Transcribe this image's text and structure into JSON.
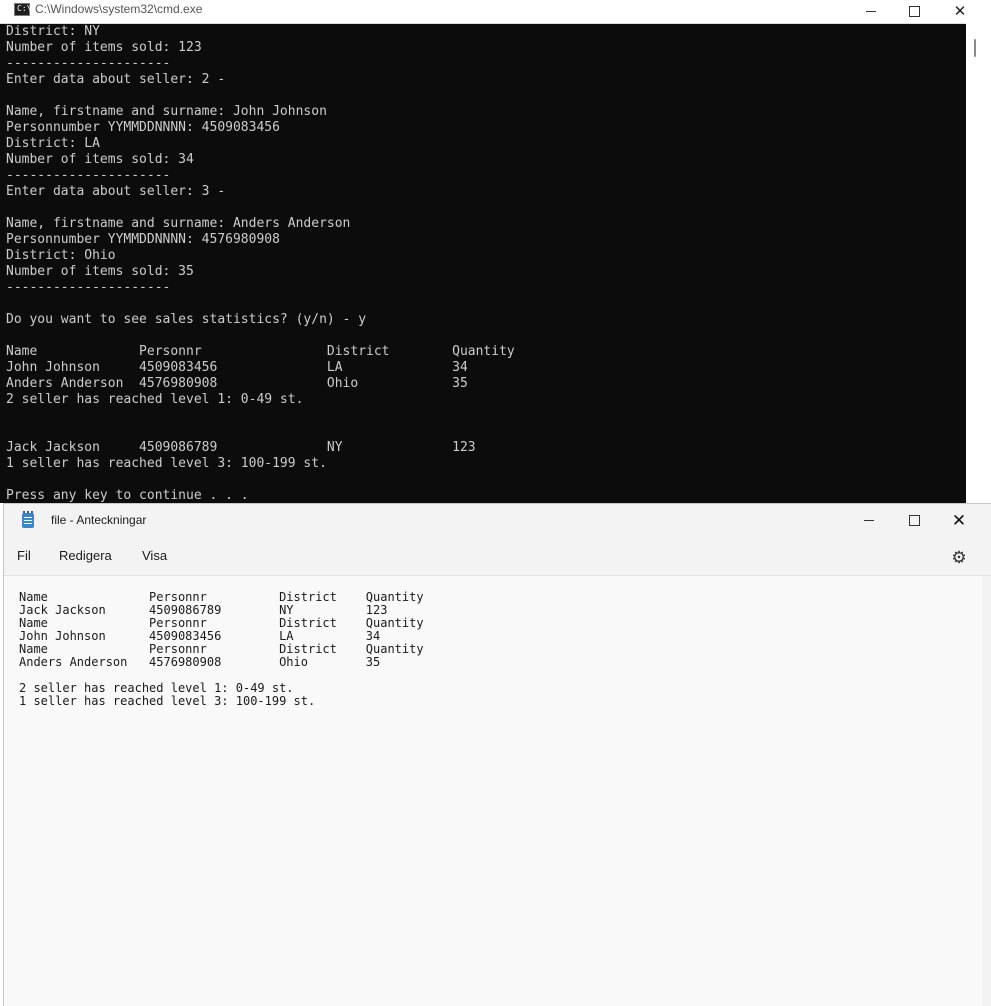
{
  "cmd": {
    "title": "C:\\Windows\\system32\\cmd.exe",
    "icon": "cmd-icon",
    "icon_text": "C:\\",
    "console_lines": [
      "District: NY",
      "Number of items sold: 123",
      "---------------------",
      "Enter data about seller: 2 -",
      "",
      "Name, firstname and surname: John Johnson",
      "Personnumber YYMMDDNNNN: 4509083456",
      "District: LA",
      "Number of items sold: 34",
      "---------------------",
      "Enter data about seller: 3 -",
      "",
      "Name, firstname and surname: Anders Anderson",
      "Personnumber YYMMDDNNNN: 4576980908",
      "District: Ohio",
      "Number of items sold: 35",
      "---------------------",
      "",
      "Do you want to see sales statistics? (y/n) - y",
      "",
      "Name             Personnr                District        Quantity",
      "John Johnson     4509083456              LA              34",
      "Anders Anderson  4576980908              Ohio            35",
      "2 seller has reached level 1: 0-49 st.",
      "",
      "",
      "Jack Jackson     4509086789              NY              123",
      "1 seller has reached level 3: 100-199 st.",
      "",
      "Press any key to continue . . ."
    ]
  },
  "notepad": {
    "title": "file - Anteckningar",
    "menu": {
      "file": "Fil",
      "edit": "Redigera",
      "view": "Visa"
    },
    "lines": [
      "Name              Personnr          District    Quantity",
      "Jack Jackson      4509086789        NY          123",
      "Name              Personnr          District    Quantity",
      "John Johnson      4509083456        LA          34",
      "Name              Personnr          District    Quantity",
      "Anders Anderson   4576980908        Ohio        35",
      "",
      "2 seller has reached level 1: 0-49 st.",
      "1 seller has reached level 3: 100-199 st."
    ]
  },
  "icons": {
    "minimize": "minimize-icon",
    "maximize": "maximize-icon",
    "close": "close-icon",
    "settings": "gear-icon",
    "notepad_app": "notepad-icon"
  },
  "colors": {
    "console_bg": "#0c0c0c",
    "console_fg": "#cccccc",
    "notepad_bg": "#f9f9f9"
  }
}
